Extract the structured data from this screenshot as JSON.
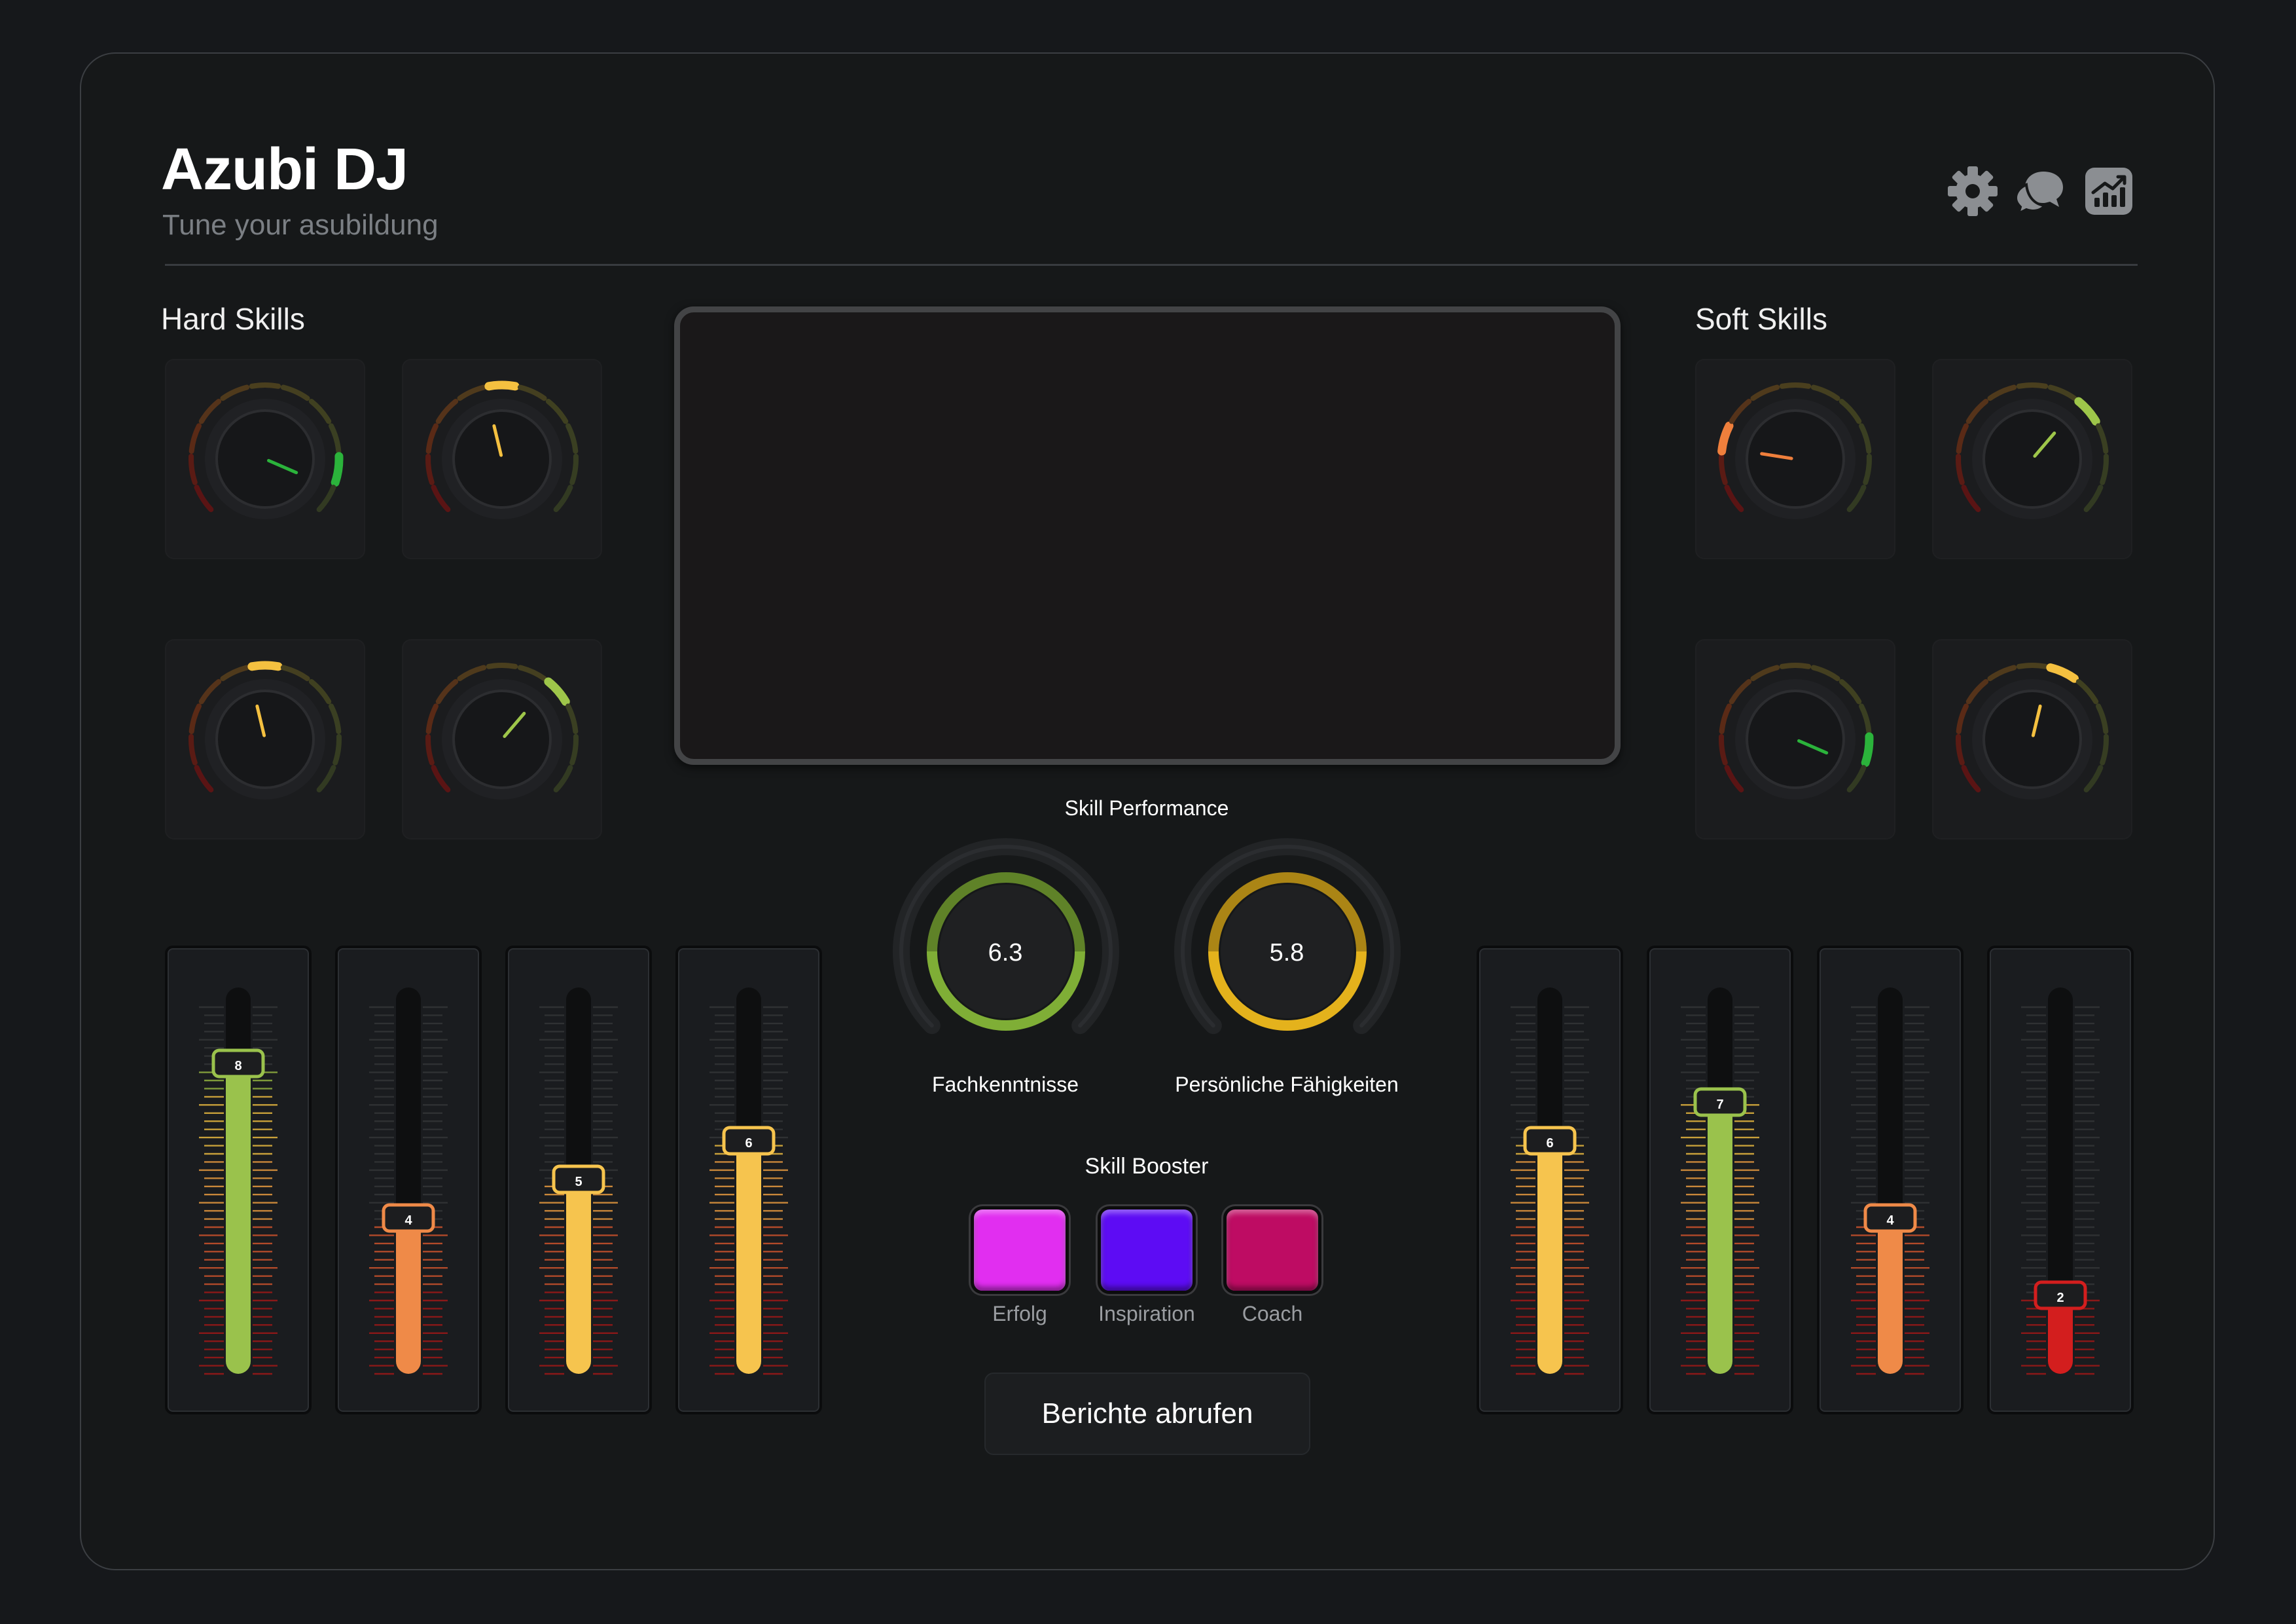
{
  "app": {
    "title": "Azubi DJ",
    "subtitle": "Tune your asubildung"
  },
  "header_icons": [
    {
      "name": "settings",
      "icon": "gear-icon"
    },
    {
      "name": "chat",
      "icon": "chat-bubbles-icon"
    },
    {
      "name": "analytics",
      "icon": "chart-icon"
    }
  ],
  "hard_skills": {
    "label": "Hard Skills",
    "knobs": [
      {
        "level": 0.92,
        "color": "#2bb33b"
      },
      {
        "level": 0.45,
        "color": "#f4c040"
      },
      {
        "level": 0.45,
        "color": "#f4c040"
      },
      {
        "level": 0.65,
        "color": "#9ec64a"
      }
    ],
    "faders": [
      {
        "value": "8",
        "level": 0.8,
        "color": "#9ac24c"
      },
      {
        "value": "4",
        "level": 0.4,
        "color": "#ef8a48"
      },
      {
        "value": "5",
        "level": 0.5,
        "color": "#f6c44e"
      },
      {
        "value": "6",
        "level": 0.6,
        "color": "#f6c44e"
      }
    ]
  },
  "soft_skills": {
    "label": "Soft Skills",
    "knobs": [
      {
        "level": 0.2,
        "color": "#ef7f3c"
      },
      {
        "level": 0.65,
        "color": "#9ec64a"
      },
      {
        "level": 0.92,
        "color": "#2bb33b"
      },
      {
        "level": 0.55,
        "color": "#f4c040"
      }
    ],
    "faders": [
      {
        "value": "6",
        "level": 0.6,
        "color": "#f6c44e"
      },
      {
        "value": "7",
        "level": 0.7,
        "color": "#9ac24c"
      },
      {
        "value": "4",
        "level": 0.4,
        "color": "#ef8a48"
      },
      {
        "value": "2",
        "level": 0.2,
        "color": "#d31e1e"
      }
    ]
  },
  "performance": {
    "label": "Skill Performance",
    "gauges": [
      {
        "value": "6.3",
        "label": "Fachkenntnisse",
        "color": "#7fae36"
      },
      {
        "value": "5.8",
        "label": "Persönliche Fähigkeiten",
        "color": "#e4b21c"
      }
    ]
  },
  "booster": {
    "label": "Skill Booster",
    "buttons": [
      {
        "label": "Erfolg",
        "color": "#e12ef0"
      },
      {
        "label": "Inspiration",
        "color": "#5d0cf4"
      },
      {
        "label": "Coach",
        "color": "#be0c63"
      }
    ]
  },
  "report_button": {
    "label": "Berichte abrufen"
  }
}
